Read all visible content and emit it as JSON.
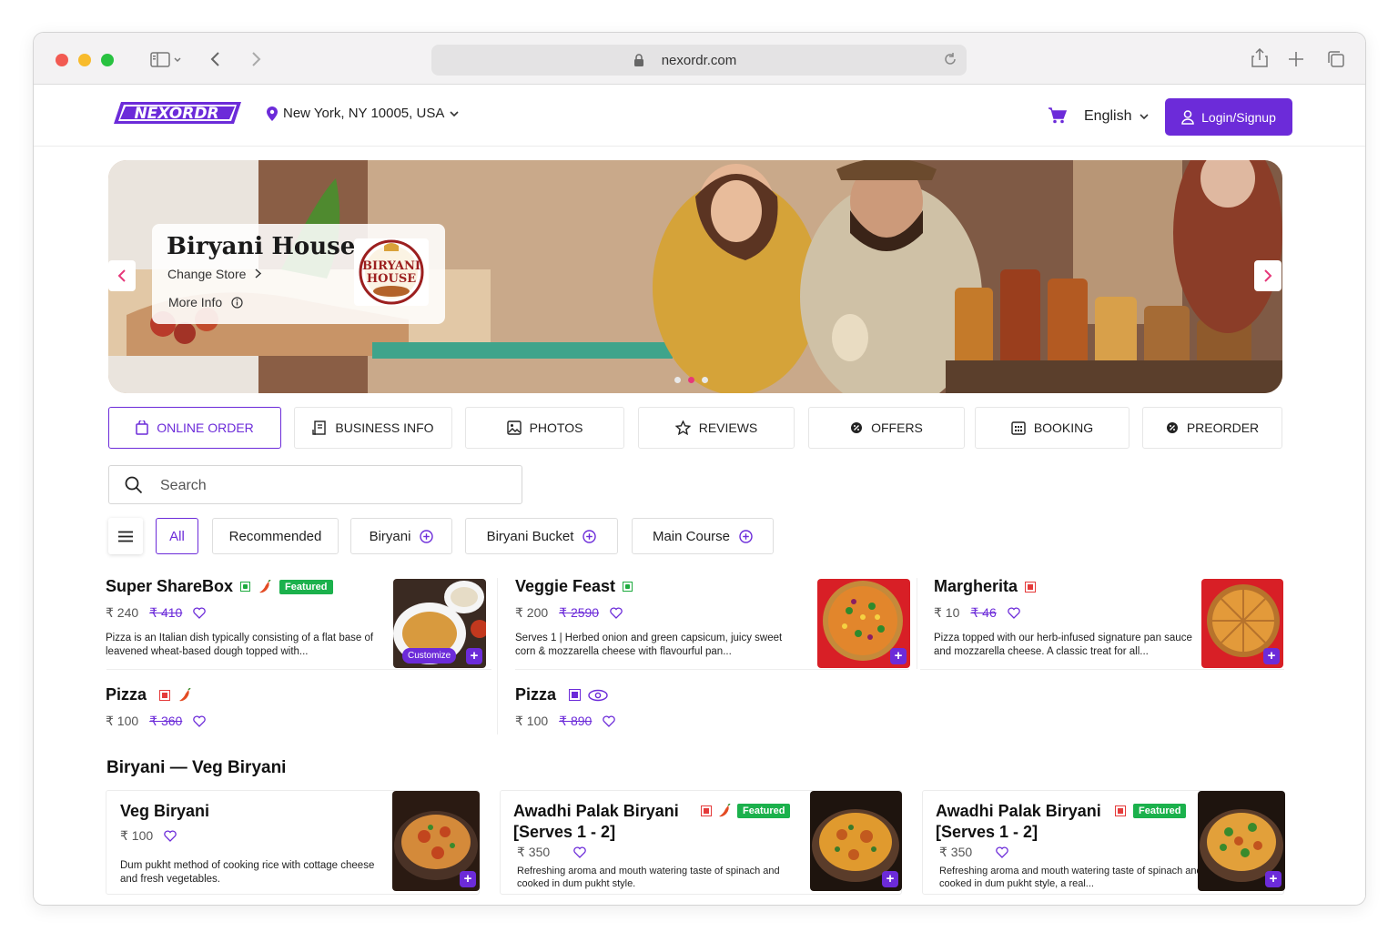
{
  "browser": {
    "url": "nexordr.com"
  },
  "header": {
    "logo_text": "NEXORDR",
    "location": "New York, NY 10005, USA",
    "language": "English",
    "login_label": "Login/Signup"
  },
  "hero": {
    "store_name": "Biryani House",
    "change_store": "Change Store",
    "more_info": "More Info",
    "store_logo_line1": "BIRYANI",
    "store_logo_line2": "HOUSE"
  },
  "tabs": [
    "ONLINE ORDER",
    "BUSINESS INFO",
    "PHOTOS",
    "REVIEWS",
    "OFFERS",
    "BOOKING",
    "PREORDER"
  ],
  "search": {
    "placeholder": "Search"
  },
  "categories": [
    "All",
    "Recommended",
    "Biryani",
    "Biryani Bucket",
    "Main Course"
  ],
  "items": [
    {
      "name": "Super ShareBox",
      "price": "₹ 240",
      "old_price": "₹ 410",
      "badge": "Featured",
      "desc": "Pizza is an Italian dish typically consisting of a flat base of leavened wheat-based dough topped with...",
      "customize": "Customize"
    },
    {
      "name": "Veggie Feast",
      "price": "₹ 200",
      "old_price": "₹ 2590",
      "desc": "Serves 1 | Herbed onion and green capsicum, juicy sweet corn & mozzarella cheese with flavourful pan..."
    },
    {
      "name": "Margherita",
      "price": "₹ 10",
      "old_price": "₹ 46",
      "desc": "Pizza topped with our herb-infused signature pan sauce and mozzarella cheese. A classic treat for all..."
    },
    {
      "name": "Pizza",
      "price": "₹ 100",
      "old_price": "₹ 360"
    },
    {
      "name": "Pizza",
      "price": "₹ 100",
      "old_price": "₹ 890"
    }
  ],
  "section": {
    "title": "Biryani — Veg Biryani",
    "items": [
      {
        "name": "Veg Biryani",
        "price": "₹ 100",
        "desc": "Dum pukht method of cooking rice with cottage cheese and fresh vegetables."
      },
      {
        "name_line1": "Awadhi Palak Biryani",
        "name_line2": "[Serves 1 - 2]",
        "price": "₹ 350",
        "badge": "Featured",
        "desc": "Refreshing aroma and mouth watering taste of spinach and cooked in dum pukht style."
      },
      {
        "name_line1": "Awadhi Palak Biryani",
        "name_line2": "[Serves 1 - 2]",
        "price": "₹ 350",
        "badge": "Featured",
        "desc": "Refreshing aroma and mouth watering taste of spinach and cooked in dum pukht style, a real..."
      }
    ]
  },
  "colors": {
    "brand": "#6c2bd9",
    "featured": "#1bb14c",
    "nonveg": "#e53b3b",
    "veg": "#1eaa3e"
  }
}
